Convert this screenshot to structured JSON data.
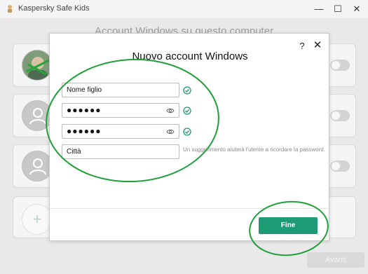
{
  "window": {
    "app_title": "Kaspersky Safe Kids",
    "minimize": "—",
    "maximize": "☐",
    "close": "✕"
  },
  "background": {
    "heading": "Account Windows su questo computer",
    "add_symbol": "+",
    "next_label": "Avanti"
  },
  "dialog": {
    "title": "Nuovo account Windows",
    "help": "?",
    "close": "✕",
    "fields": {
      "name": "Nome figlio",
      "password": "●●●●●●",
      "password_confirm": "●●●●●●",
      "hint": "Città"
    },
    "hint_text": "Un suggerimento aiuterà l'utente a ricordare la password.",
    "finish_label": "Fine"
  },
  "colors": {
    "accent": "#1c9b74",
    "annotation": "#1fa03a",
    "check": "#1c9b74"
  }
}
